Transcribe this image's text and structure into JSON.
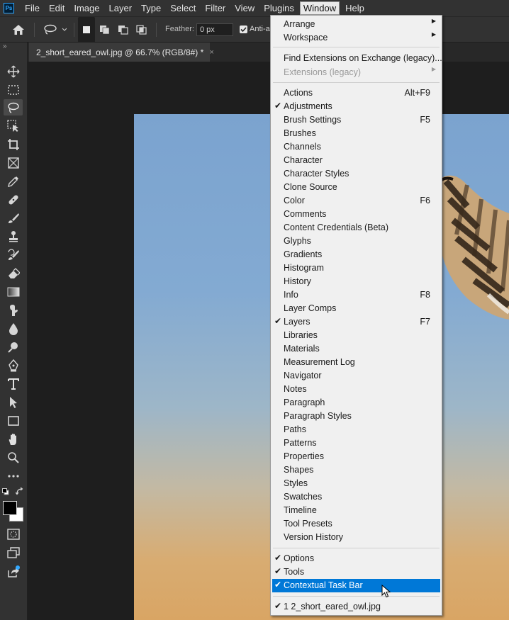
{
  "menubar": {
    "items": [
      {
        "label": "File"
      },
      {
        "label": "Edit"
      },
      {
        "label": "Image"
      },
      {
        "label": "Layer"
      },
      {
        "label": "Type"
      },
      {
        "label": "Select"
      },
      {
        "label": "Filter"
      },
      {
        "label": "View"
      },
      {
        "label": "Plugins"
      },
      {
        "label": "Window"
      },
      {
        "label": "Help"
      }
    ],
    "active": "Window"
  },
  "logo_text": "Ps",
  "options_bar": {
    "feather_label": "Feather:",
    "feather_value": "0 px",
    "antialias_label": "Anti-a"
  },
  "document_tab": {
    "title": "2_short_eared_owl.jpg @ 66.7% (RGB/8#) *",
    "close_glyph": "×"
  },
  "window_menu": {
    "group1": [
      {
        "label": "Arrange",
        "submenu": true
      },
      {
        "label": "Workspace",
        "submenu": true
      }
    ],
    "group2": [
      {
        "label": "Find Extensions on Exchange (legacy)..."
      },
      {
        "label": "Extensions (legacy)",
        "submenu": true,
        "disabled": true
      }
    ],
    "panels": [
      {
        "label": "Actions",
        "shortcut": "Alt+F9"
      },
      {
        "label": "Adjustments",
        "checked": true
      },
      {
        "label": "Brush Settings",
        "shortcut": "F5"
      },
      {
        "label": "Brushes"
      },
      {
        "label": "Channels"
      },
      {
        "label": "Character"
      },
      {
        "label": "Character Styles"
      },
      {
        "label": "Clone Source"
      },
      {
        "label": "Color",
        "shortcut": "F6"
      },
      {
        "label": "Comments"
      },
      {
        "label": "Content Credentials (Beta)"
      },
      {
        "label": "Glyphs"
      },
      {
        "label": "Gradients"
      },
      {
        "label": "Histogram"
      },
      {
        "label": "History"
      },
      {
        "label": "Info",
        "shortcut": "F8"
      },
      {
        "label": "Layer Comps"
      },
      {
        "label": "Layers",
        "checked": true,
        "shortcut": "F7"
      },
      {
        "label": "Libraries"
      },
      {
        "label": "Materials"
      },
      {
        "label": "Measurement Log"
      },
      {
        "label": "Navigator"
      },
      {
        "label": "Notes"
      },
      {
        "label": "Paragraph"
      },
      {
        "label": "Paragraph Styles"
      },
      {
        "label": "Paths"
      },
      {
        "label": "Patterns"
      },
      {
        "label": "Properties"
      },
      {
        "label": "Shapes"
      },
      {
        "label": "Styles"
      },
      {
        "label": "Swatches"
      },
      {
        "label": "Timeline"
      },
      {
        "label": "Tool Presets"
      },
      {
        "label": "Version History"
      }
    ],
    "group4": [
      {
        "label": "Options",
        "checked": true
      },
      {
        "label": "Tools",
        "checked": true
      },
      {
        "label": "Contextual Task Bar",
        "checked": true,
        "highlighted": true
      }
    ],
    "group5": [
      {
        "label": "1 2_short_eared_owl.jpg",
        "checked": true
      }
    ]
  },
  "tools": [
    "move-tool-icon",
    "marquee-tool-icon",
    "lasso-tool-icon",
    "object-selection-tool-icon",
    "crop-tool-icon",
    "frame-tool-icon",
    "eyedropper-tool-icon",
    "healing-brush-tool-icon",
    "brush-tool-icon",
    "clone-stamp-tool-icon",
    "history-brush-tool-icon",
    "eraser-tool-icon",
    "gradient-tool-icon",
    "smudge-tool-icon",
    "blur-tool-icon",
    "dodge-tool-icon",
    "pen-tool-icon",
    "type-tool-icon",
    "path-selection-tool-icon",
    "rectangle-tool-icon",
    "hand-tool-icon",
    "zoom-tool-icon",
    "more-tools-icon"
  ],
  "colors": {
    "foreground": "#000000",
    "background": "#ffffff",
    "highlight": "#0078d7",
    "menu_bg": "#f0f0f0",
    "app_bg": "#323232"
  }
}
